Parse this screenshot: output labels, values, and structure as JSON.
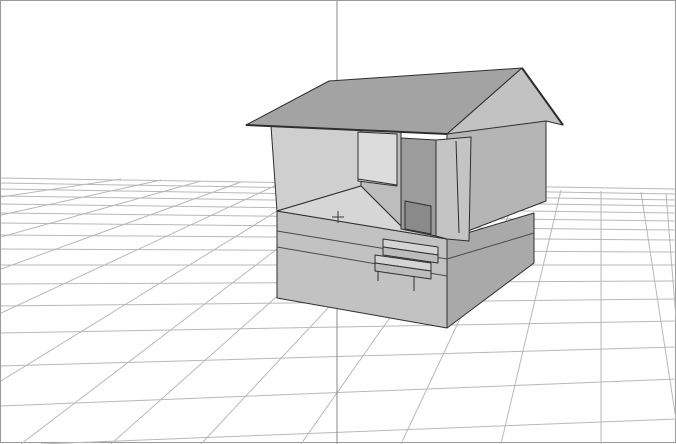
{
  "viewport": {
    "background_color": "#ffffff",
    "grid_color": "#b8b8b8",
    "axis_color": "#8a8a8a",
    "model_outline_color": "#2e2e2e",
    "model_fill_color": "#c9c9c9"
  },
  "icons": {
    "cursor": "crosshair-icon"
  }
}
